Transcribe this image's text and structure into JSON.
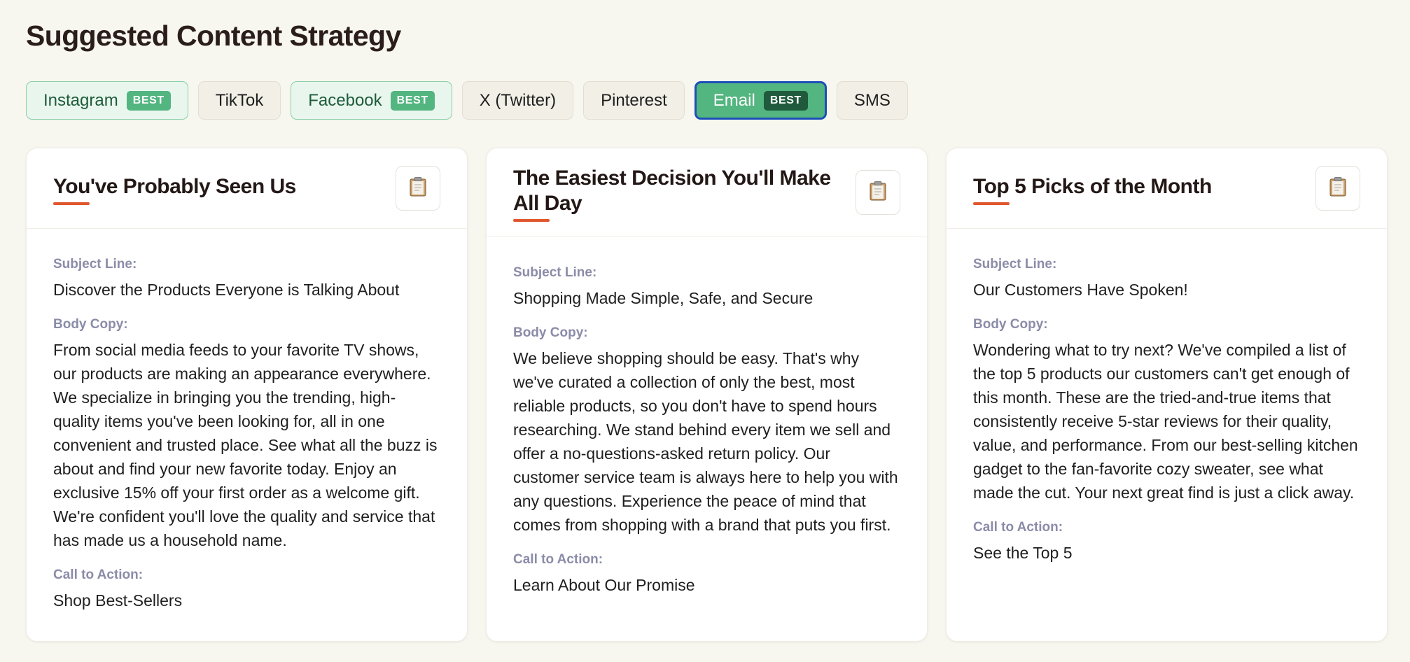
{
  "page_title": "Suggested Content Strategy",
  "tabs": [
    {
      "label": "Instagram",
      "badge": "BEST"
    },
    {
      "label": "TikTok"
    },
    {
      "label": "Facebook",
      "badge": "BEST"
    },
    {
      "label": "X (Twitter)"
    },
    {
      "label": "Pinterest"
    },
    {
      "label": "Email",
      "badge": "BEST"
    },
    {
      "label": "SMS"
    }
  ],
  "labels": {
    "subject": "Subject Line:",
    "body": "Body Copy:",
    "cta": "Call to Action:"
  },
  "cards": [
    {
      "title": "You've Probably Seen Us",
      "subject": "Discover the Products Everyone is Talking About",
      "body": "From social media feeds to your favorite TV shows, our products are making an appearance everywhere. We specialize in bringing you the trending, high-quality items you've been looking for, all in one convenient and trusted place. See what all the buzz is about and find your new favorite today. Enjoy an exclusive 15% off your first order as a welcome gift. We're confident you'll love the quality and service that has made us a household name.",
      "cta": "Shop Best-Sellers"
    },
    {
      "title": "The Easiest Decision You'll Make All Day",
      "subject": "Shopping Made Simple, Safe, and Secure",
      "body": "We believe shopping should be easy. That's why we've curated a collection of only the best, most reliable products, so you don't have to spend hours researching. We stand behind every item we sell and offer a no-questions-asked return policy. Our customer service team is always here to help you with any questions. Experience the peace of mind that comes from shopping with a brand that puts you first.",
      "cta": "Learn About Our Promise"
    },
    {
      "title": "Top 5 Picks of the Month",
      "subject": "Our Customers Have Spoken!",
      "body": "Wondering what to try next? We've compiled a list of the top 5 products our customers can't get enough of this month. These are the tried-and-true items that consistently receive 5-star reviews for their quality, value, and performance. From our best-selling kitchen gadget to the fan-favorite cozy sweater, see what made the cut. Your next great find is just a click away.",
      "cta": "See the Top 5"
    }
  ],
  "colors": {
    "accent_underline": "#e0572e",
    "best_green": "#53b57f",
    "active_border": "#1d4fb8",
    "label_gray": "#8a8ca8"
  },
  "icons": {
    "copy": "clipboard-icon"
  }
}
